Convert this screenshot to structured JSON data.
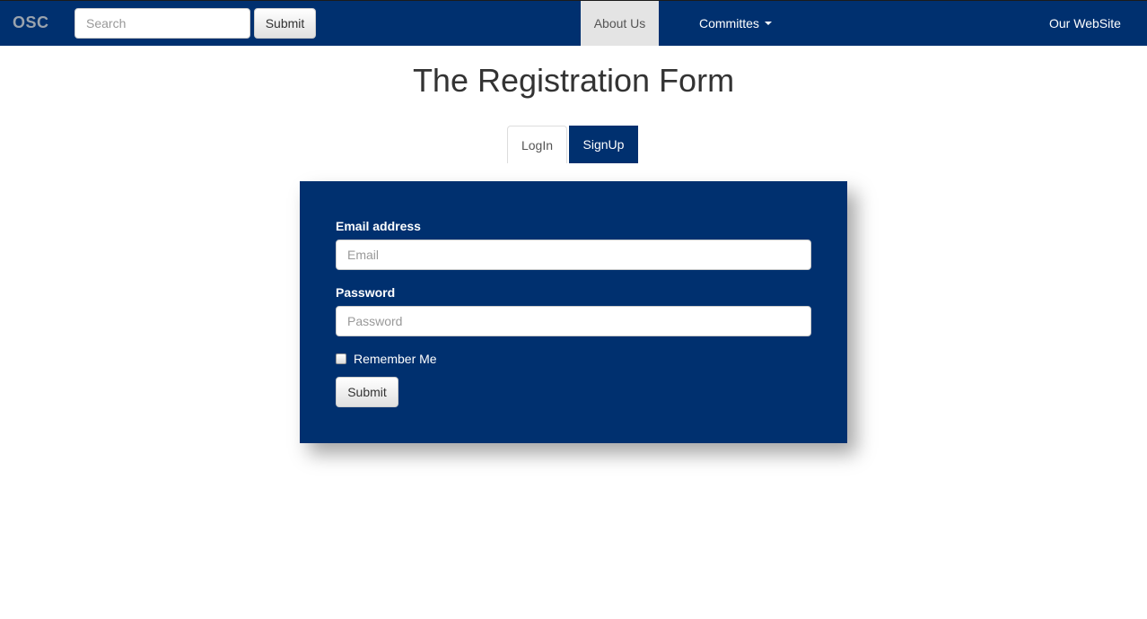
{
  "navbar": {
    "brand": "OSC",
    "search_placeholder": "Search",
    "submit_label": "Submit",
    "about_label": "About Us",
    "committees_label": "Committes",
    "website_label": "Our WebSite"
  },
  "page": {
    "title": "The Registration Form"
  },
  "tabs": [
    {
      "label": "LogIn",
      "active": false
    },
    {
      "label": "SignUp",
      "active": true
    }
  ],
  "form": {
    "email_label": "Email address",
    "email_placeholder": "Email",
    "email_value": "",
    "password_label": "Password",
    "password_placeholder": "Password",
    "password_value": "",
    "remember_label": "Remember Me",
    "remember_checked": false,
    "submit_label": "Submit"
  },
  "colors": {
    "primary": "#00306f",
    "active_nav_bg": "#e4e4e4",
    "white": "#ffffff"
  }
}
